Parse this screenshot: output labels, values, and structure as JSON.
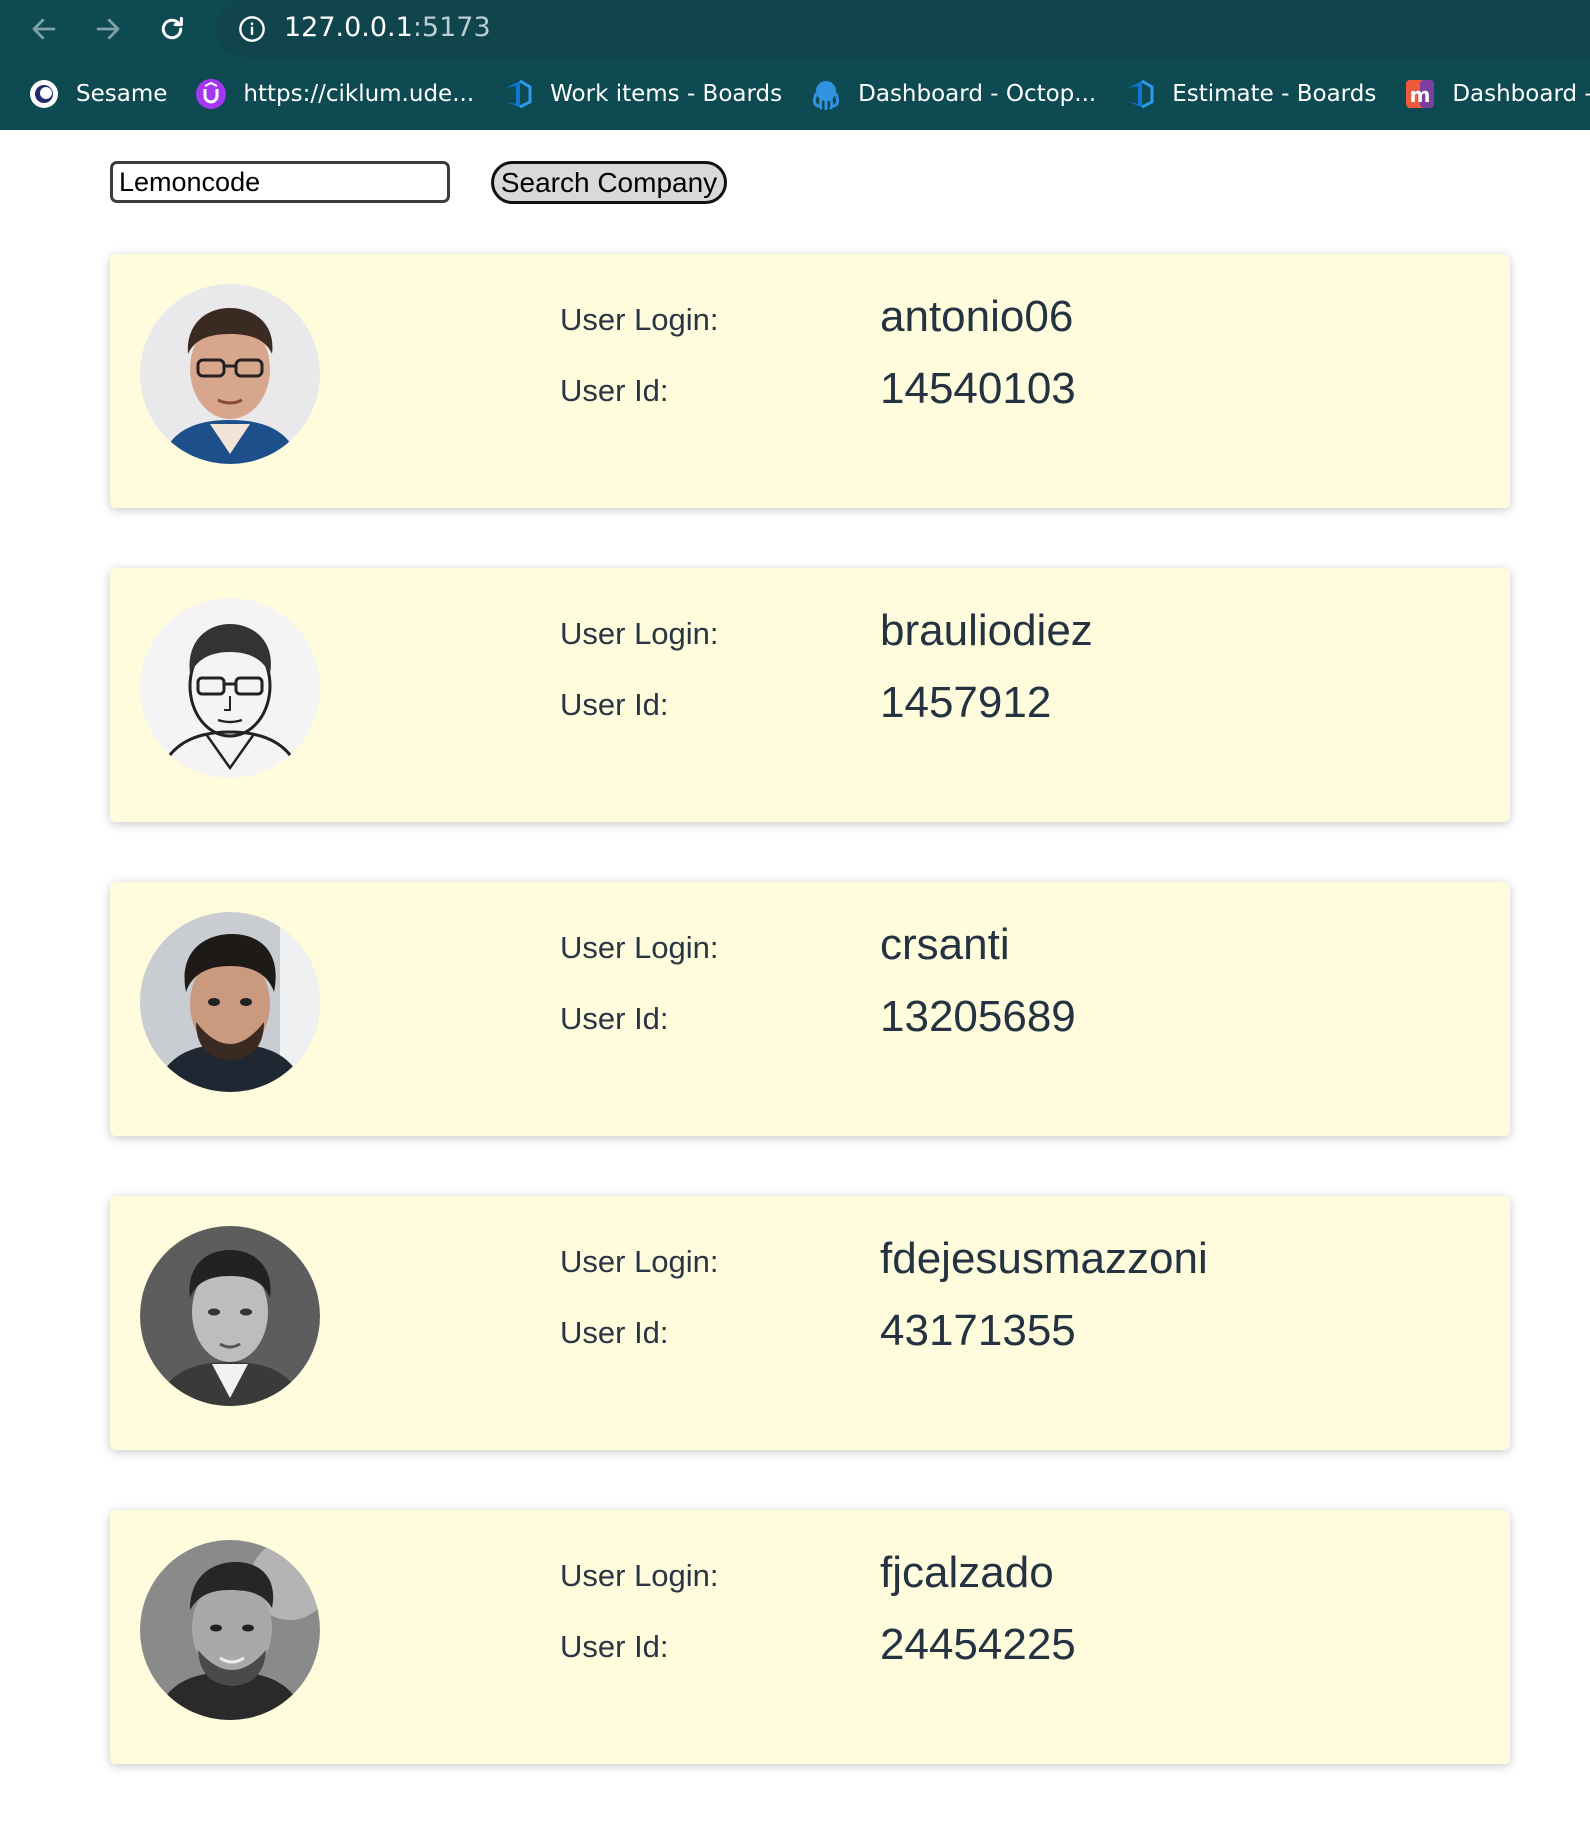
{
  "browser": {
    "url_host": "127.0.0.1",
    "url_port": ":5173",
    "bookmarks": [
      {
        "label": "Sesame",
        "icon": "sesame-icon"
      },
      {
        "label": "https://ciklum.ude...",
        "icon": "udemy-icon"
      },
      {
        "label": "Work items - Boards",
        "icon": "azure-devops-icon"
      },
      {
        "label": "Dashboard - Octop...",
        "icon": "octopus-icon"
      },
      {
        "label": "Estimate - Boards",
        "icon": "azure-devops-icon"
      },
      {
        "label": "Dashboard - MyCik",
        "icon": "mycik-icon"
      }
    ]
  },
  "search": {
    "value": "Lemoncode",
    "button_label": "Search Company"
  },
  "labels": {
    "login": "User Login:",
    "id": "User Id:"
  },
  "members": [
    {
      "login": "antonio06",
      "id": "14540103",
      "avatar": "photo-portrait-color"
    },
    {
      "login": "brauliodiez",
      "id": "1457912",
      "avatar": "sketch-portrait"
    },
    {
      "login": "crsanti",
      "id": "13205689",
      "avatar": "photo-portrait-color"
    },
    {
      "login": "fdejesusmazzoni",
      "id": "43171355",
      "avatar": "photo-portrait-grayscale"
    },
    {
      "login": "fjcalzado",
      "id": "24454225",
      "avatar": "photo-portrait-grayscale"
    }
  ],
  "colors": {
    "chrome": "#0e4a52",
    "card": "#fefcdc",
    "text": "#243241"
  }
}
